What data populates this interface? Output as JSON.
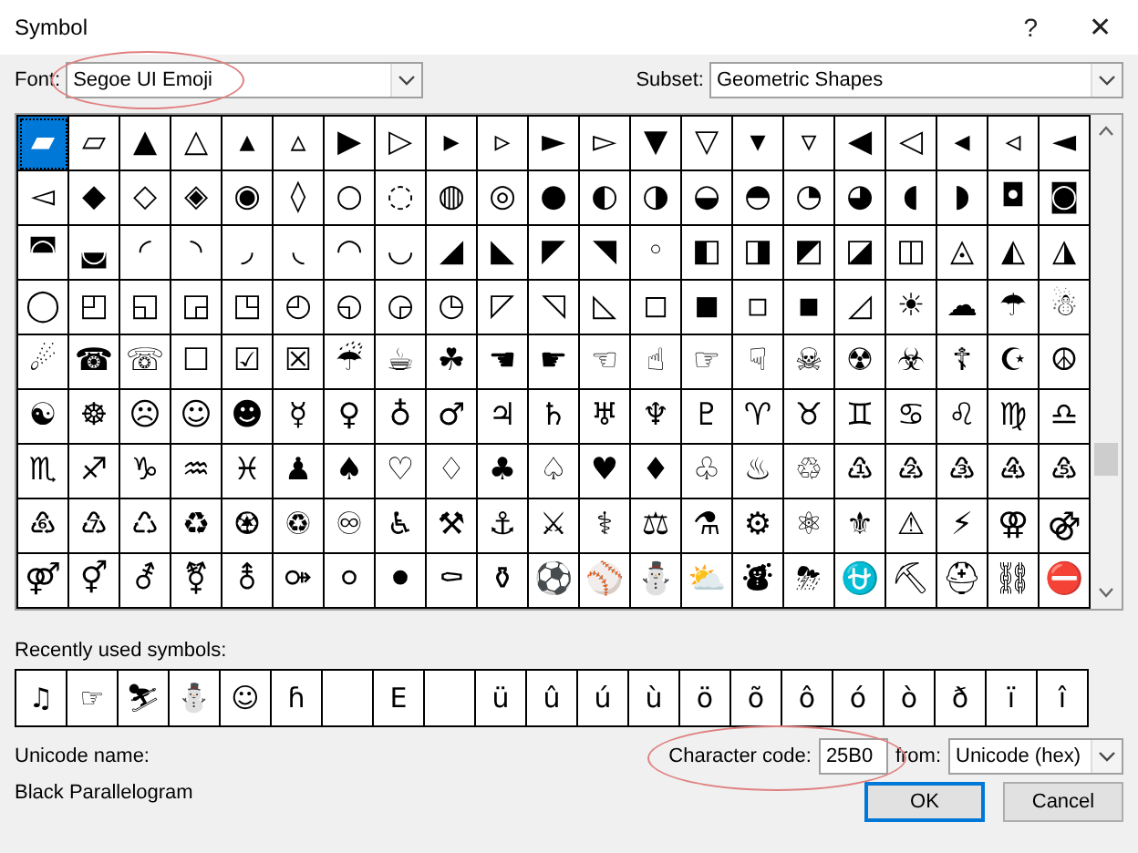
{
  "window": {
    "title": "Symbol",
    "help_glyph": "?",
    "close_glyph": "✕"
  },
  "font": {
    "label": "Font:",
    "value": "Segoe UI Emoji",
    "highlighted": true
  },
  "subset": {
    "label": "Subset:",
    "value": "Geometric Shapes"
  },
  "grid": [
    [
      {
        "symbol": "▰",
        "selected": true
      },
      {
        "symbol": "▱",
        "selected": false
      },
      {
        "symbol": "▲",
        "selected": false
      },
      {
        "symbol": "△",
        "selected": false
      },
      {
        "symbol": "▴",
        "selected": false
      },
      {
        "symbol": "▵",
        "selected": false
      },
      {
        "symbol": "▶",
        "selected": false
      },
      {
        "symbol": "▷",
        "selected": false
      },
      {
        "symbol": "▸",
        "selected": false
      },
      {
        "symbol": "▹",
        "selected": false
      },
      {
        "symbol": "►",
        "selected": false
      },
      {
        "symbol": "▻",
        "selected": false
      },
      {
        "symbol": "▼",
        "selected": false
      },
      {
        "symbol": "▽",
        "selected": false
      },
      {
        "symbol": "▾",
        "selected": false
      },
      {
        "symbol": "▿",
        "selected": false
      },
      {
        "symbol": "◀",
        "selected": false
      },
      {
        "symbol": "◁",
        "selected": false
      },
      {
        "symbol": "◂",
        "selected": false
      },
      {
        "symbol": "◃",
        "selected": false
      },
      {
        "symbol": "◄",
        "selected": false
      }
    ],
    [
      {
        "symbol": "◅",
        "selected": false
      },
      {
        "symbol": "◆",
        "selected": false
      },
      {
        "symbol": "◇",
        "selected": false
      },
      {
        "symbol": "◈",
        "selected": false
      },
      {
        "symbol": "◉",
        "selected": false
      },
      {
        "symbol": "◊",
        "selected": false
      },
      {
        "symbol": "○",
        "selected": false
      },
      {
        "symbol": "◌",
        "selected": false
      },
      {
        "symbol": "◍",
        "selected": false
      },
      {
        "symbol": "◎",
        "selected": false
      },
      {
        "symbol": "●",
        "selected": false
      },
      {
        "symbol": "◐",
        "selected": false
      },
      {
        "symbol": "◑",
        "selected": false
      },
      {
        "symbol": "◒",
        "selected": false
      },
      {
        "symbol": "◓",
        "selected": false
      },
      {
        "symbol": "◔",
        "selected": false
      },
      {
        "symbol": "◕",
        "selected": false
      },
      {
        "symbol": "◖",
        "selected": false
      },
      {
        "symbol": "◗",
        "selected": false
      },
      {
        "symbol": "◘",
        "selected": false
      },
      {
        "symbol": "◙",
        "selected": false
      }
    ],
    [
      {
        "symbol": "◚",
        "selected": false
      },
      {
        "symbol": "◛",
        "selected": false
      },
      {
        "symbol": "◜",
        "selected": false
      },
      {
        "symbol": "◝",
        "selected": false
      },
      {
        "symbol": "◞",
        "selected": false
      },
      {
        "symbol": "◟",
        "selected": false
      },
      {
        "symbol": "◠",
        "selected": false
      },
      {
        "symbol": "◡",
        "selected": false
      },
      {
        "symbol": "◢",
        "selected": false
      },
      {
        "symbol": "◣",
        "selected": false
      },
      {
        "symbol": "◤",
        "selected": false
      },
      {
        "symbol": "◥",
        "selected": false
      },
      {
        "symbol": "◦",
        "selected": false
      },
      {
        "symbol": "◧",
        "selected": false
      },
      {
        "symbol": "◨",
        "selected": false
      },
      {
        "symbol": "◩",
        "selected": false
      },
      {
        "symbol": "◪",
        "selected": false
      },
      {
        "symbol": "◫",
        "selected": false
      },
      {
        "symbol": "◬",
        "selected": false
      },
      {
        "symbol": "◭",
        "selected": false
      },
      {
        "symbol": "◮",
        "selected": false
      }
    ],
    [
      {
        "symbol": "◯",
        "selected": false
      },
      {
        "symbol": "◰",
        "selected": false
      },
      {
        "symbol": "◱",
        "selected": false
      },
      {
        "symbol": "◲",
        "selected": false
      },
      {
        "symbol": "◳",
        "selected": false
      },
      {
        "symbol": "◴",
        "selected": false
      },
      {
        "symbol": "◵",
        "selected": false
      },
      {
        "symbol": "◶",
        "selected": false
      },
      {
        "symbol": "◷",
        "selected": false
      },
      {
        "symbol": "◸",
        "selected": false
      },
      {
        "symbol": "◹",
        "selected": false
      },
      {
        "symbol": "◺",
        "selected": false
      },
      {
        "symbol": "◻",
        "selected": false
      },
      {
        "symbol": "◼",
        "selected": false
      },
      {
        "symbol": "◽",
        "selected": false
      },
      {
        "symbol": "◾",
        "selected": false
      },
      {
        "symbol": "◿",
        "selected": false
      },
      {
        "symbol": "☀",
        "selected": false
      },
      {
        "symbol": "☁",
        "selected": false
      },
      {
        "symbol": "☂",
        "selected": false
      },
      {
        "symbol": "☃",
        "selected": false
      }
    ],
    [
      {
        "symbol": "☄",
        "selected": false
      },
      {
        "symbol": "☎",
        "selected": false
      },
      {
        "symbol": "☏",
        "selected": false
      },
      {
        "symbol": "☐",
        "selected": false
      },
      {
        "symbol": "☑",
        "selected": false
      },
      {
        "symbol": "☒",
        "selected": false
      },
      {
        "symbol": "☔",
        "selected": false
      },
      {
        "symbol": "☕",
        "selected": false
      },
      {
        "symbol": "☘",
        "selected": false
      },
      {
        "symbol": "☚",
        "selected": false
      },
      {
        "symbol": "☛",
        "selected": false
      },
      {
        "symbol": "☜",
        "selected": false
      },
      {
        "symbol": "☝",
        "selected": false
      },
      {
        "symbol": "☞",
        "selected": false
      },
      {
        "symbol": "☟",
        "selected": false
      },
      {
        "symbol": "☠",
        "selected": false
      },
      {
        "symbol": "☢",
        "selected": false
      },
      {
        "symbol": "☣",
        "selected": false
      },
      {
        "symbol": "☦",
        "selected": false
      },
      {
        "symbol": "☪",
        "selected": false
      },
      {
        "symbol": "☮",
        "selected": false
      }
    ],
    [
      {
        "symbol": "☯",
        "selected": false
      },
      {
        "symbol": "☸",
        "selected": false
      },
      {
        "symbol": "☹",
        "selected": false
      },
      {
        "symbol": "☺",
        "selected": false
      },
      {
        "symbol": "☻",
        "selected": false
      },
      {
        "symbol": "☿",
        "selected": false
      },
      {
        "symbol": "♀",
        "selected": false
      },
      {
        "symbol": "♁",
        "selected": false
      },
      {
        "symbol": "♂",
        "selected": false
      },
      {
        "symbol": "♃",
        "selected": false
      },
      {
        "symbol": "♄",
        "selected": false
      },
      {
        "symbol": "♅",
        "selected": false
      },
      {
        "symbol": "♆",
        "selected": false
      },
      {
        "symbol": "♇",
        "selected": false
      },
      {
        "symbol": "♈",
        "selected": false
      },
      {
        "symbol": "♉",
        "selected": false
      },
      {
        "symbol": "♊",
        "selected": false
      },
      {
        "symbol": "♋",
        "selected": false
      },
      {
        "symbol": "♌",
        "selected": false
      },
      {
        "symbol": "♍",
        "selected": false
      },
      {
        "symbol": "♎",
        "selected": false
      }
    ],
    [
      {
        "symbol": "♏",
        "selected": false
      },
      {
        "symbol": "♐",
        "selected": false
      },
      {
        "symbol": "♑",
        "selected": false
      },
      {
        "symbol": "♒",
        "selected": false
      },
      {
        "symbol": "♓",
        "selected": false
      },
      {
        "symbol": "♟",
        "selected": false
      },
      {
        "symbol": "♠",
        "selected": false
      },
      {
        "symbol": "♡",
        "selected": false
      },
      {
        "symbol": "♢",
        "selected": false
      },
      {
        "symbol": "♣",
        "selected": false
      },
      {
        "symbol": "♤",
        "selected": false
      },
      {
        "symbol": "♥",
        "selected": false
      },
      {
        "symbol": "♦",
        "selected": false
      },
      {
        "symbol": "♧",
        "selected": false
      },
      {
        "symbol": "♨",
        "selected": false
      },
      {
        "symbol": "♲",
        "selected": false
      },
      {
        "symbol": "♳",
        "selected": false
      },
      {
        "symbol": "♴",
        "selected": false
      },
      {
        "symbol": "♵",
        "selected": false
      },
      {
        "symbol": "♶",
        "selected": false
      },
      {
        "symbol": "♷",
        "selected": false
      }
    ],
    [
      {
        "symbol": "♸",
        "selected": false
      },
      {
        "symbol": "♹",
        "selected": false
      },
      {
        "symbol": "♺",
        "selected": false
      },
      {
        "symbol": "♻",
        "selected": false
      },
      {
        "symbol": "♼",
        "selected": false
      },
      {
        "symbol": "♽",
        "selected": false
      },
      {
        "symbol": "♾",
        "selected": false
      },
      {
        "symbol": "♿",
        "selected": false
      },
      {
        "symbol": "⚒",
        "selected": false
      },
      {
        "symbol": "⚓",
        "selected": false
      },
      {
        "symbol": "⚔",
        "selected": false
      },
      {
        "symbol": "⚕",
        "selected": false
      },
      {
        "symbol": "⚖",
        "selected": false
      },
      {
        "symbol": "⚗",
        "selected": false
      },
      {
        "symbol": "⚙",
        "selected": false
      },
      {
        "symbol": "⚛",
        "selected": false
      },
      {
        "symbol": "⚜",
        "selected": false
      },
      {
        "symbol": "⚠",
        "selected": false
      },
      {
        "symbol": "⚡",
        "selected": false
      },
      {
        "symbol": "⚢",
        "selected": false
      },
      {
        "symbol": "⚣",
        "selected": false
      }
    ],
    [
      {
        "symbol": "⚤",
        "selected": false
      },
      {
        "symbol": "⚥",
        "selected": false
      },
      {
        "symbol": "⚦",
        "selected": false
      },
      {
        "symbol": "⚧",
        "selected": false
      },
      {
        "symbol": "⚨",
        "selected": false
      },
      {
        "symbol": "⚩",
        "selected": false
      },
      {
        "symbol": "⚪",
        "selected": false
      },
      {
        "symbol": "⚫",
        "selected": false
      },
      {
        "symbol": "⚰",
        "selected": false
      },
      {
        "symbol": "⚱",
        "selected": false
      },
      {
        "symbol": "⚽",
        "selected": false
      },
      {
        "symbol": "⚾",
        "selected": false
      },
      {
        "symbol": "⛄",
        "selected": false
      },
      {
        "symbol": "⛅",
        "selected": false
      },
      {
        "symbol": "⛇",
        "selected": false
      },
      {
        "symbol": "⛈",
        "selected": false
      },
      {
        "symbol": "⛎",
        "selected": false
      },
      {
        "symbol": "⛏",
        "selected": false
      },
      {
        "symbol": "⛑",
        "selected": false
      },
      {
        "symbol": "⛓",
        "selected": false
      },
      {
        "symbol": "⛔",
        "selected": false
      }
    ]
  ],
  "recent": {
    "label": "Recently used symbols:",
    "cells": [
      {
        "kind": "glyph",
        "symbol": "♫"
      },
      {
        "kind": "glyph",
        "symbol": "☞"
      },
      {
        "kind": "glyph",
        "symbol": "⛷"
      },
      {
        "kind": "glyph",
        "symbol": "⛄"
      },
      {
        "kind": "glyph",
        "symbol": "☺"
      },
      {
        "kind": "glyph",
        "symbol": "ɦ"
      },
      {
        "kind": "empty"
      },
      {
        "kind": "glyph",
        "symbol": "E"
      },
      {
        "kind": "empty"
      },
      {
        "kind": "glyph",
        "symbol": "ü"
      },
      {
        "kind": "glyph",
        "symbol": "û"
      },
      {
        "kind": "glyph",
        "symbol": "ú"
      },
      {
        "kind": "glyph",
        "symbol": "ù"
      },
      {
        "kind": "glyph",
        "symbol": "ö"
      },
      {
        "kind": "glyph",
        "symbol": "õ"
      },
      {
        "kind": "glyph",
        "symbol": "ô"
      },
      {
        "kind": "glyph",
        "symbol": "ó"
      },
      {
        "kind": "glyph",
        "symbol": "ò"
      },
      {
        "kind": "glyph",
        "symbol": "ð"
      },
      {
        "kind": "glyph",
        "symbol": "ï"
      },
      {
        "kind": "glyph",
        "symbol": "î"
      }
    ]
  },
  "unicode_name": {
    "label": "Unicode name:",
    "value": "Black Parallelogram"
  },
  "character_code": {
    "label": "Character code:",
    "value": "25B0",
    "highlighted": true
  },
  "from": {
    "label": "from:",
    "value": "Unicode (hex)"
  },
  "buttons": [
    {
      "label": "OK",
      "default": true
    },
    {
      "label": "Cancel",
      "default": false
    }
  ]
}
